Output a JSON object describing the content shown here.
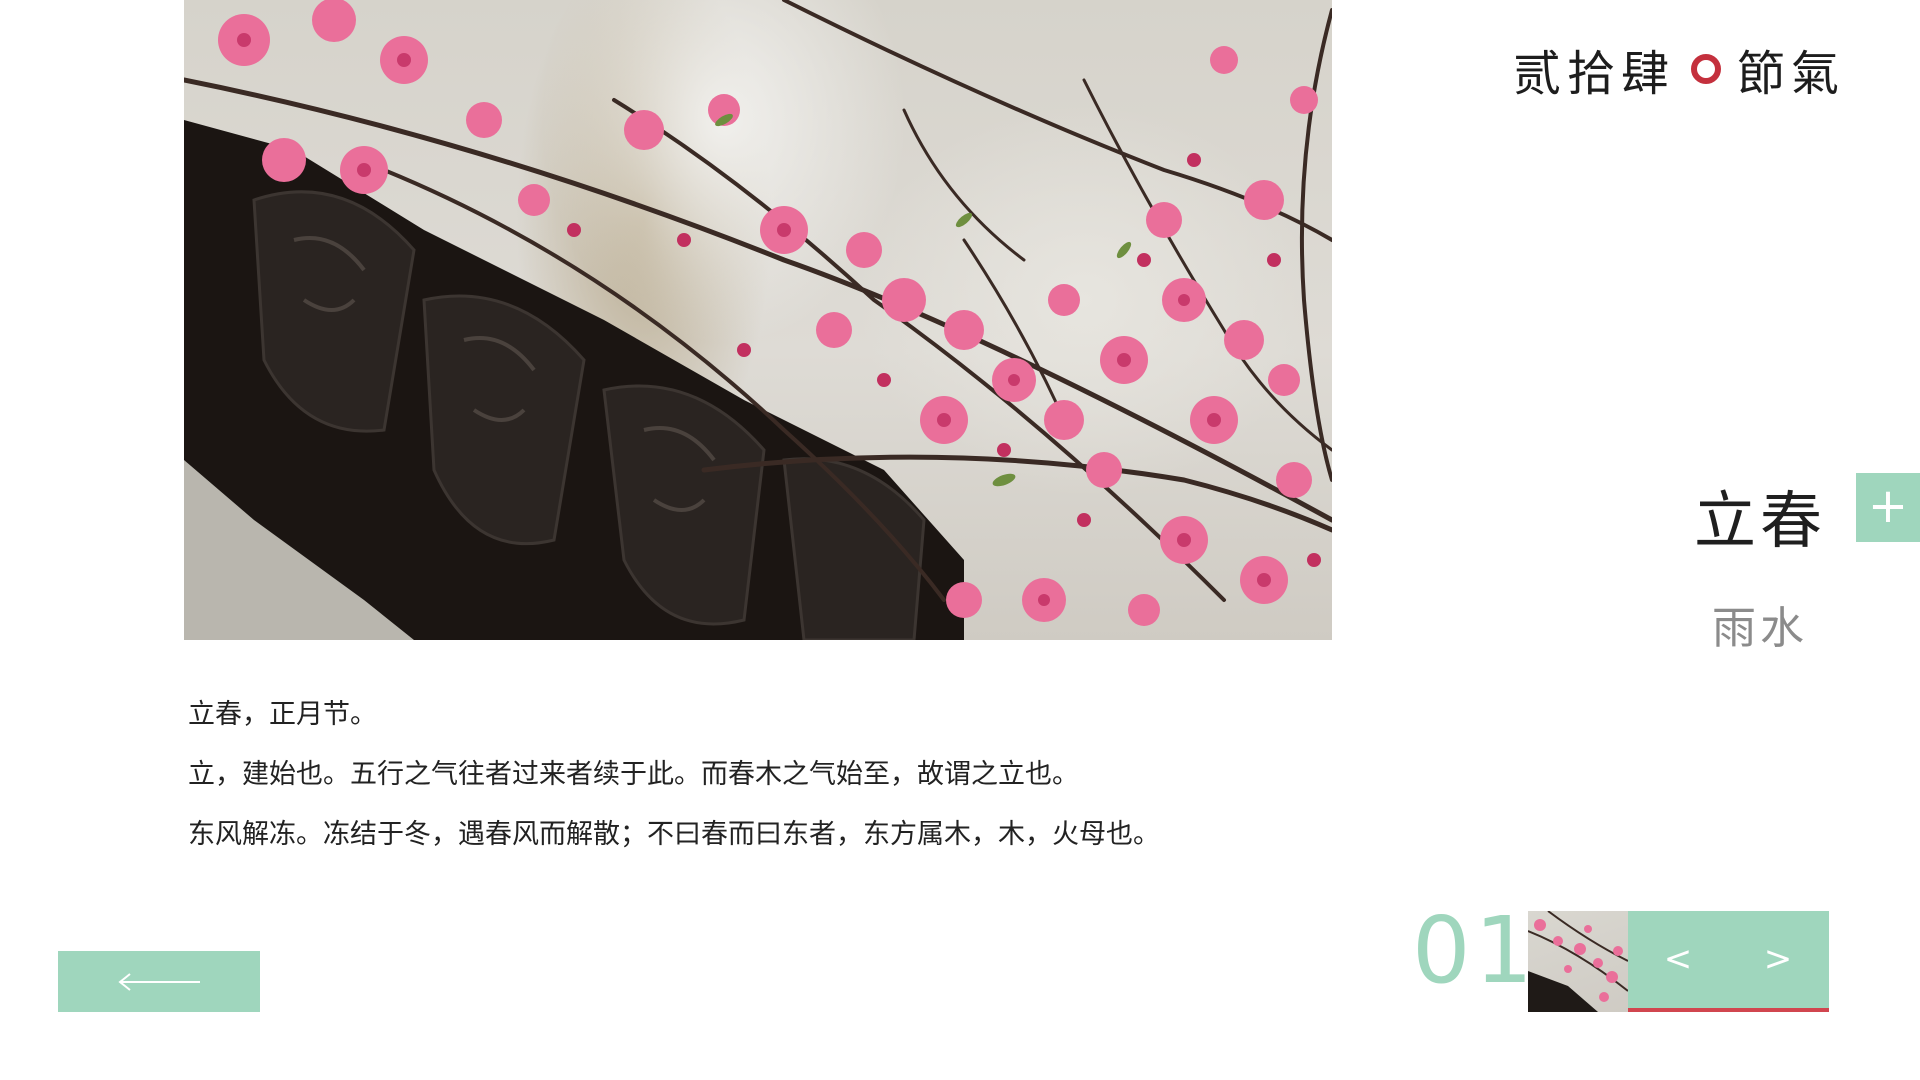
{
  "brand": {
    "part1": "贰拾肆",
    "part2": "節氣",
    "accent_color": "#c4303d"
  },
  "hero": {
    "icon": "plum-blossom-photo"
  },
  "terms": {
    "current": "立春",
    "next": "雨水"
  },
  "plus_button": {
    "label": "+",
    "color": "#9fd6bd"
  },
  "description": {
    "lines": [
      "立春，正月节。",
      "立，建始也。五行之气往者过来者续于此。而春木之气始至，故谓之立也。",
      "东风解冻。冻结于冬，遇春风而解散；不曰春而曰东者，东方属木，木，火母也。"
    ]
  },
  "controls": {
    "back_icon": "arrow-left-long-icon",
    "page_number": "01",
    "prev_label": "<",
    "next_label": ">",
    "accent_color": "#9fd6bd",
    "indicator_color": "#d1464f"
  }
}
